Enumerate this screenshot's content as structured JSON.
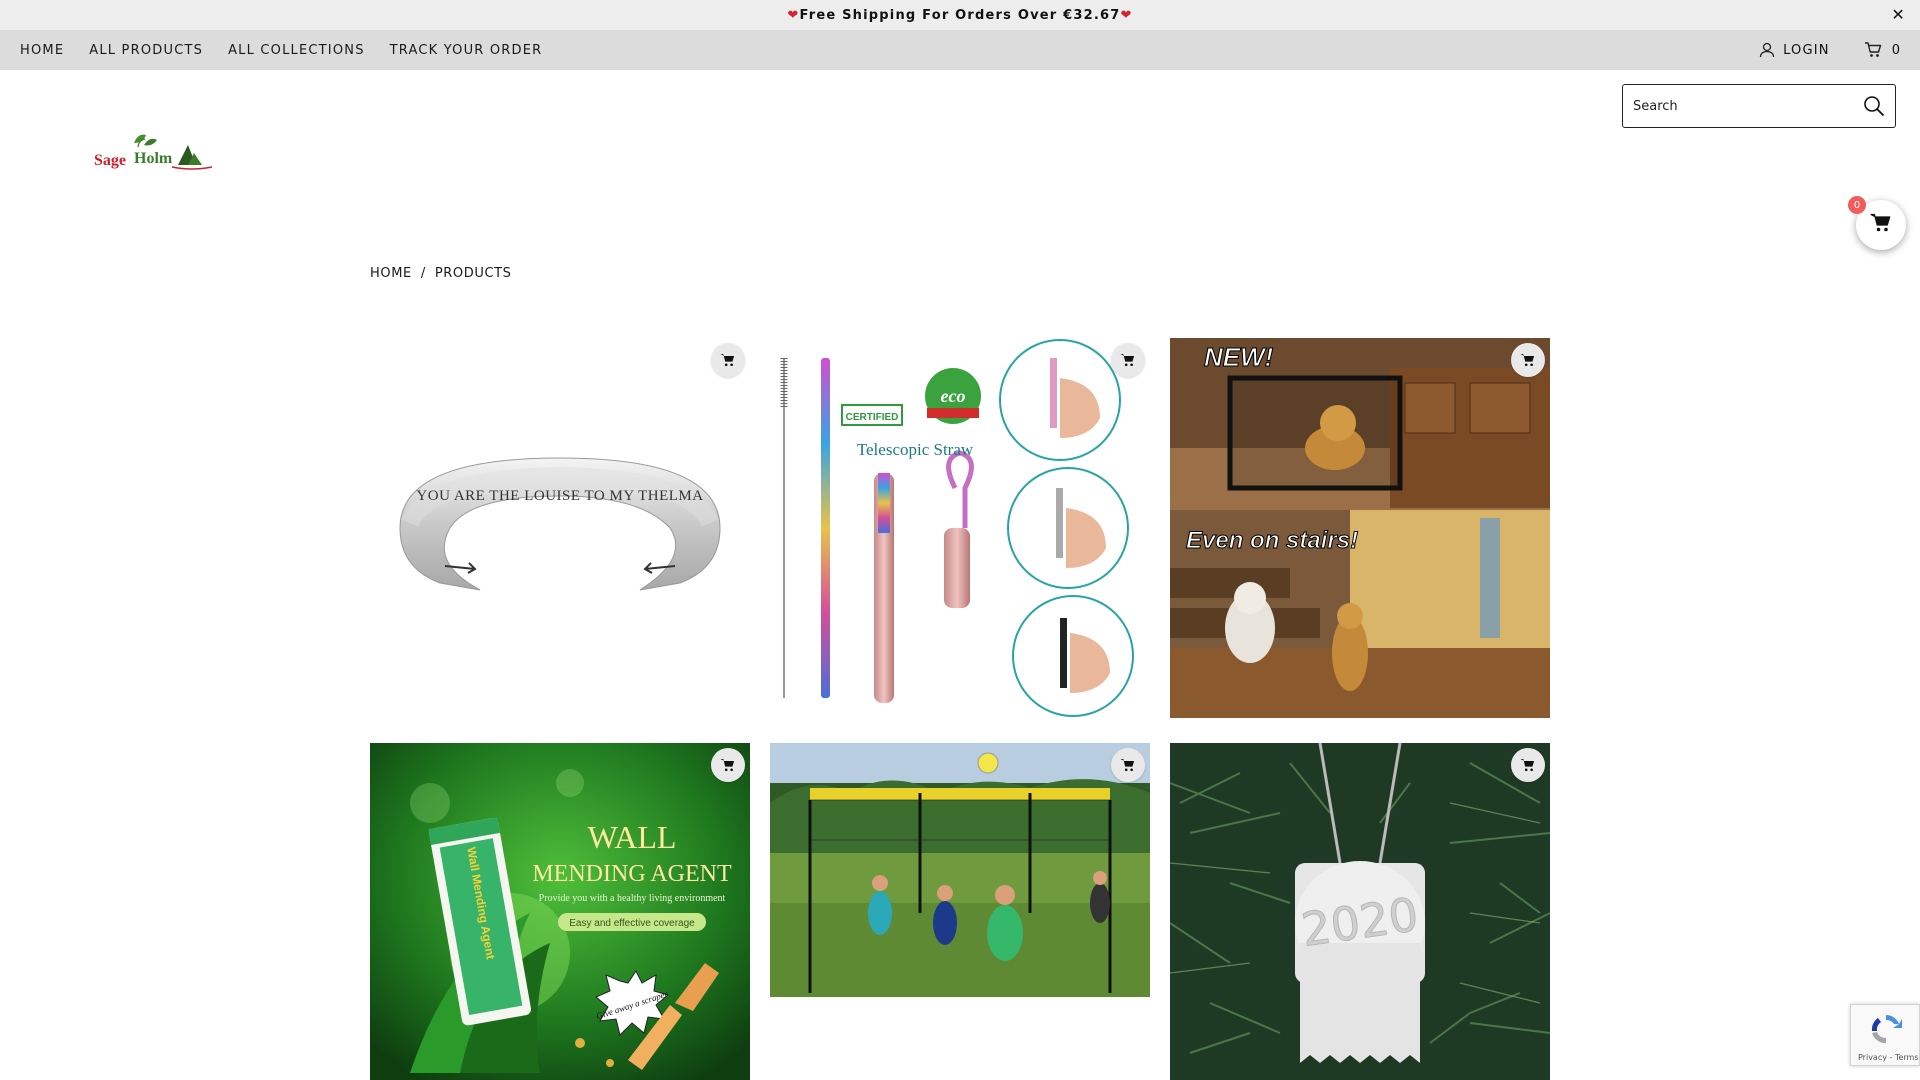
{
  "announcement": {
    "text": "Free Shipping For Orders Over €32.67",
    "close_symbol": "✕"
  },
  "nav": {
    "links": [
      "HOME",
      "ALL PRODUCTS",
      "ALL COLLECTIONS",
      "TRACK YOUR ORDER"
    ],
    "login_label": "LOGIN",
    "cart_count": "0"
  },
  "brand": {
    "logo_text_a": "Sage",
    "logo_text_b": "Holm",
    "color_red": "#c8202f",
    "color_green": "#3a7d2c"
  },
  "search": {
    "placeholder": "Search"
  },
  "floating_cart": {
    "count": "0"
  },
  "breadcrumb": {
    "home": "HOME",
    "separator": "/",
    "current": "PRODUCTS"
  },
  "products": [
    {
      "image_text": "YOU ARE THE LOUISE TO MY THELMA"
    },
    {
      "badge_certified": "CERTIFIED",
      "badge_eco": "eco",
      "caption": "Telescopic Straw"
    },
    {
      "top_text": "NEW!",
      "bottom_text": "Even on stairs!"
    },
    {
      "title_line1": "WALL",
      "title_line2": "MENDING AGENT",
      "subtitle": "Provide you with a healthy living environment",
      "pill": "Easy and effective coverage",
      "burst_text": "Give away a scraper",
      "tube_text": "Wall Mending Agent"
    },
    {},
    {
      "roll_text": "2020"
    }
  ],
  "recaptcha": {
    "terms": "Privacy - Terms"
  }
}
